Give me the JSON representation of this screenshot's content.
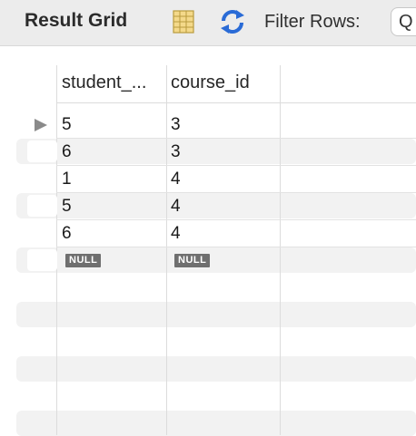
{
  "toolbar": {
    "title": "Result Grid",
    "filter_label": "Filter Rows:",
    "filter_value": "Q"
  },
  "grid": {
    "columns": [
      "student_...",
      "course_id"
    ],
    "rows": [
      {
        "student": "5",
        "course": "3"
      },
      {
        "student": "6",
        "course": "3"
      },
      {
        "student": "1",
        "course": "4"
      },
      {
        "student": "5",
        "course": "4"
      },
      {
        "student": "6",
        "course": "4"
      }
    ],
    "null_row": {
      "student": "NULL",
      "course": "NULL"
    }
  },
  "icons": [
    "grid-view-icon",
    "refresh-icon",
    "current-row-arrow-icon"
  ],
  "colors": {
    "toolbar_bg": "#ececec",
    "band": "#f2f2f2",
    "null_badge": "#6f6f6f"
  }
}
